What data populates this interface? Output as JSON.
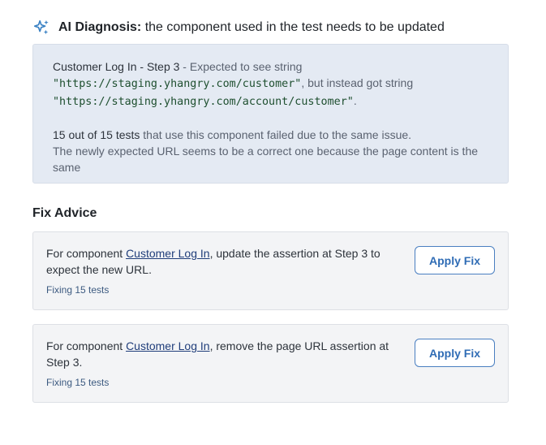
{
  "diagnosis": {
    "icon": "sparkles-icon",
    "icon_color": "#3b82c4",
    "label": "AI Diagnosis:",
    "summary": "the component used in the test needs to be updated",
    "step_label": "Customer Log In - Step 3",
    "expected_prefix": " - Expected to see string",
    "expected_url": "\"https://staging.yhangry.com/customer\"",
    "but_text": ", but instead got string",
    "actual_url": "\"https://staging.yhangry.com/account/customer\"",
    "period": ".",
    "count_text": "15 out of 15 tests",
    "count_rest": " that use this component failed due to the same issue.",
    "explanation": "The newly expected URL seems to be a correct one because the page content is the same"
  },
  "fix_advice": {
    "title": "Fix Advice",
    "items": [
      {
        "prefix": "For component ",
        "component": "Customer Log In",
        "suffix": ", update the assertion at Step 3 to expect the new URL.",
        "fixing": "Fixing 15 tests",
        "button": "Apply Fix"
      },
      {
        "prefix": "For component ",
        "component": "Customer Log In",
        "suffix": ", remove the page URL assertion at Step 3.",
        "fixing": "Fixing 15 tests",
        "button": "Apply Fix"
      }
    ]
  },
  "colors": {
    "diagnosis_bg": "#e4eaf3",
    "card_bg": "#f3f4f6",
    "button_border": "#4a7fc1",
    "link": "#1f3d7a"
  }
}
